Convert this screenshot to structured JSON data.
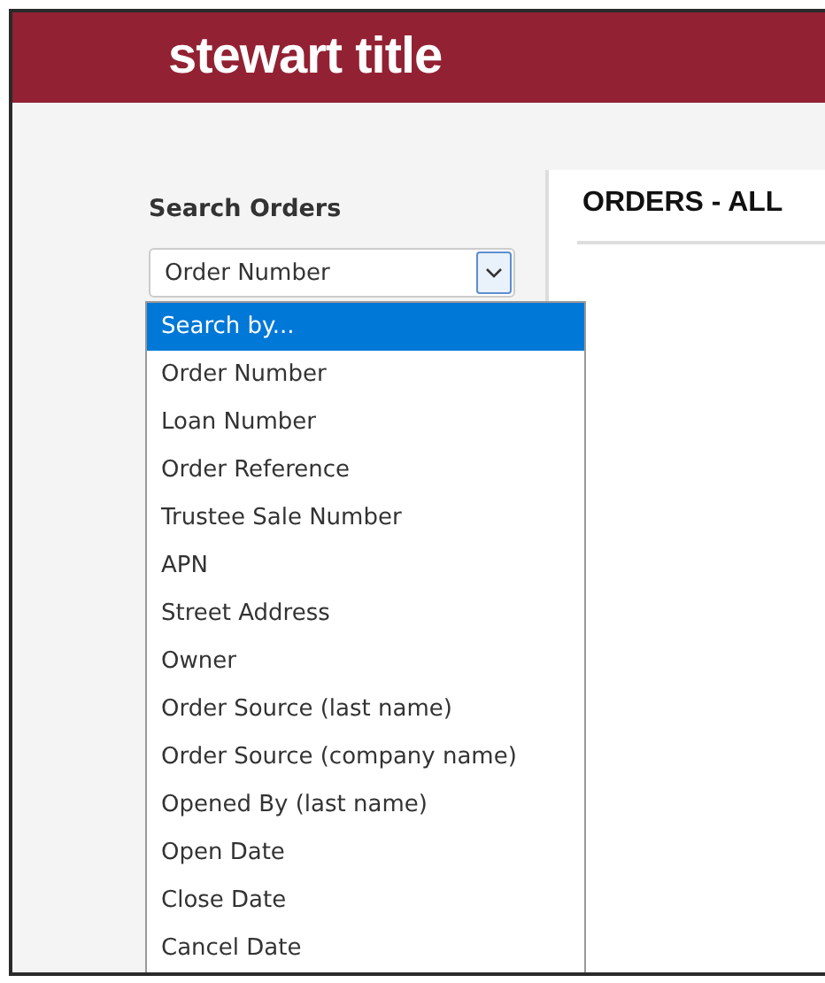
{
  "header": {
    "logo": "stewart title"
  },
  "sidebar": {
    "title": "Search Orders",
    "select": {
      "value": "Order Number",
      "expanded": true,
      "options": [
        {
          "label": "Search by...",
          "highlighted": true
        },
        {
          "label": "Order Number",
          "highlighted": false
        },
        {
          "label": "Loan Number",
          "highlighted": false
        },
        {
          "label": "Order Reference",
          "highlighted": false
        },
        {
          "label": "Trustee Sale Number",
          "highlighted": false
        },
        {
          "label": "APN",
          "highlighted": false
        },
        {
          "label": "Street Address",
          "highlighted": false
        },
        {
          "label": "Owner",
          "highlighted": false
        },
        {
          "label": "Order Source (last name)",
          "highlighted": false
        },
        {
          "label": "Order Source (company name)",
          "highlighted": false
        },
        {
          "label": "Opened By (last name)",
          "highlighted": false
        },
        {
          "label": "Open Date",
          "highlighted": false
        },
        {
          "label": "Close Date",
          "highlighted": false
        },
        {
          "label": "Cancel Date",
          "highlighted": false
        }
      ]
    }
  },
  "main": {
    "title": "ORDERS - ALL"
  }
}
